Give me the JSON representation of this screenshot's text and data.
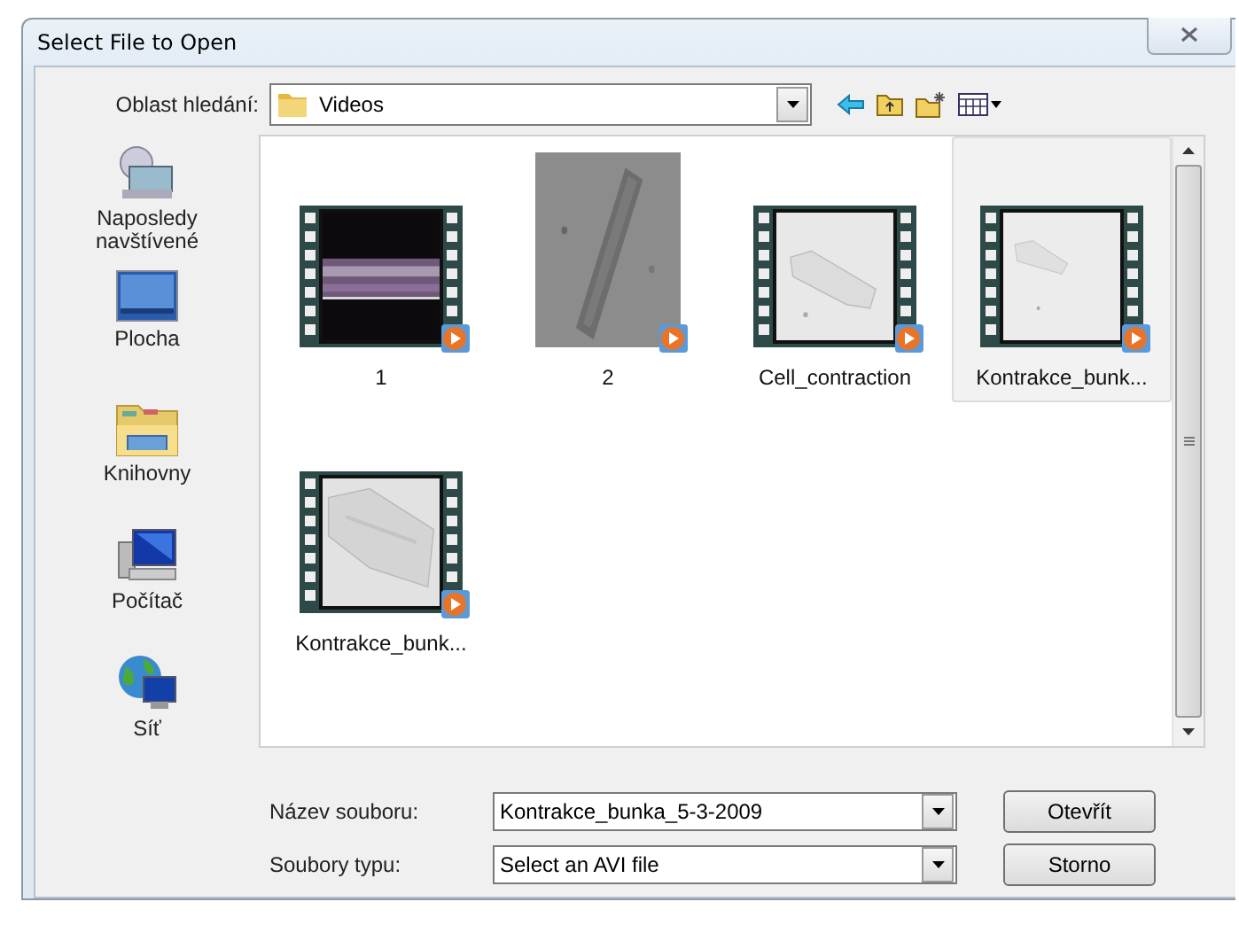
{
  "window": {
    "title": "Select File to Open"
  },
  "look_in": {
    "label": "Oblast hledání:",
    "value": "Videos"
  },
  "places": [
    {
      "kind": "recent",
      "label": "Naposledy navštívené"
    },
    {
      "kind": "desktop",
      "label": "Plocha"
    },
    {
      "kind": "libraries",
      "label": "Knihovny"
    },
    {
      "kind": "computer",
      "label": "Počítač"
    },
    {
      "kind": "network",
      "label": "Síť"
    }
  ],
  "files": [
    {
      "name": "1",
      "kind": "filmstrip",
      "selected": false
    },
    {
      "name": "2",
      "kind": "frame",
      "selected": false
    },
    {
      "name": "Cell_contraction",
      "kind": "filmstrip",
      "selected": false
    },
    {
      "name": "Kontrakce_bunk...",
      "kind": "filmstrip",
      "selected": true
    },
    {
      "name": "Kontrakce_bunk...",
      "kind": "filmstrip",
      "selected": false
    }
  ],
  "file_name": {
    "label": "Název souboru:",
    "value": "Kontrakce_bunka_5-3-2009"
  },
  "file_type": {
    "label": "Soubory typu:",
    "value": "Select an AVI file"
  },
  "buttons": [
    "Otevřít",
    "Storno"
  ]
}
